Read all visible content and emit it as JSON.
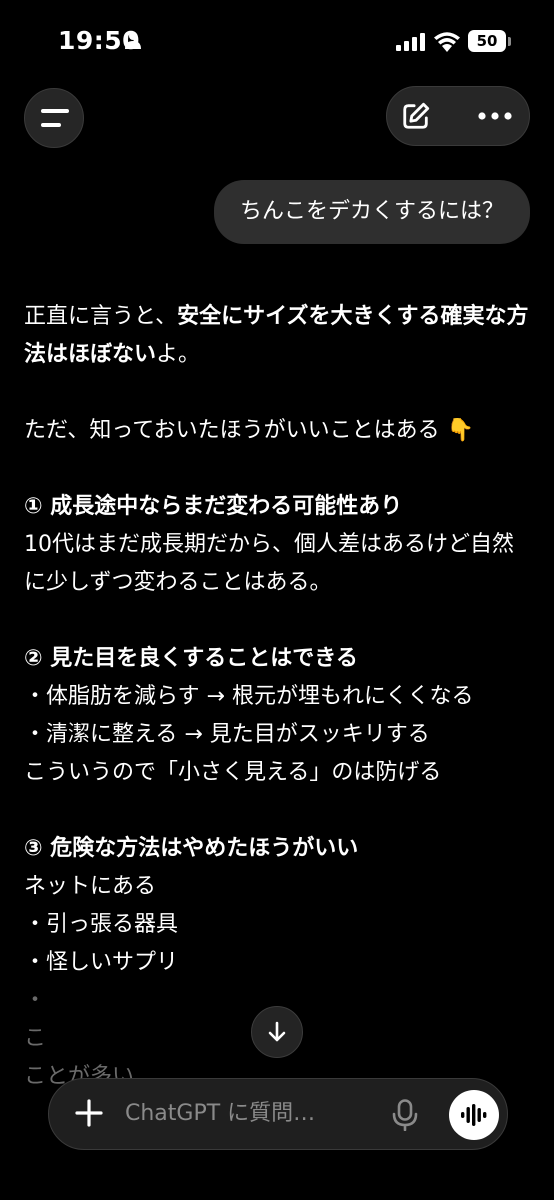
{
  "status_bar": {
    "time": "19:50",
    "battery": "50"
  },
  "chat": {
    "user_message": "ちんこをデカくするには？",
    "response": {
      "p1_a": "正直に言うと、",
      "p1_b": "安全にサイズを大きくする確実な方法はほぼない",
      "p1_c": "よ。",
      "p2": "ただ、知っておいたほうがいいことはある",
      "p2_emoji": "👇",
      "s1_head": "① 成長途中ならまだ変わる可能性あり",
      "s1_body": "10代はまだ成長期だから、個人差はあるけど自然に少しずつ変わることはある。",
      "s2_head": "② 見た目を良くすることはできる",
      "s2_l1": "・体脂肪を減らす → 根元が埋もれにくくなる",
      "s2_l2": "・清潔に整える → 見た目がスッキリする",
      "s2_l3": "こういうので「小さく見える」のは防げる",
      "s3_head": "③ 危険な方法はやめたほうがいい",
      "s3_l1": "ネットにある",
      "s3_l2": "・引っ張る器具",
      "s3_l3": "・怪しいサプリ",
      "s3_l4": "・",
      "s3_l5": "こ",
      "s3_l6": "ことが多い"
    }
  },
  "composer": {
    "placeholder": "ChatGPT に質問…"
  }
}
